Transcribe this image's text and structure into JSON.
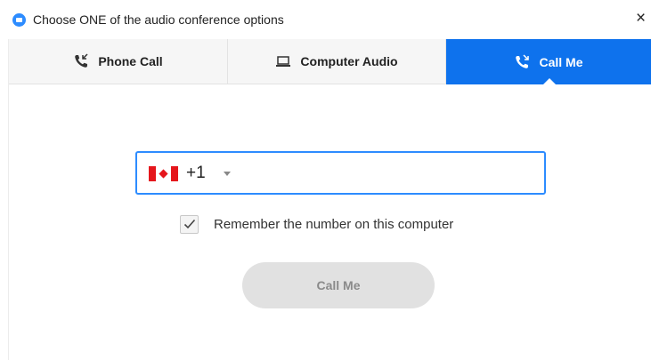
{
  "window": {
    "title": "Choose ONE of the audio conference options",
    "close_glyph": "×"
  },
  "tabs": [
    {
      "label": "Phone Call",
      "icon": "phone-icon",
      "active": false
    },
    {
      "label": "Computer Audio",
      "icon": "laptop-icon",
      "active": false
    },
    {
      "label": "Call Me",
      "icon": "phone-callback-icon",
      "active": true
    }
  ],
  "call_me": {
    "country": "Canada",
    "country_flag_icon": "canada-flag-icon",
    "country_code": "+1",
    "phone_number_value": "",
    "remember_checked": true,
    "remember_label": "Remember the number on this computer",
    "button_label": "Call Me"
  },
  "colors": {
    "accent": "#0e72ed",
    "input_border": "#2d8cff",
    "button_disabled_bg": "#e1e1e1",
    "button_disabled_text": "#8a8a8a"
  }
}
